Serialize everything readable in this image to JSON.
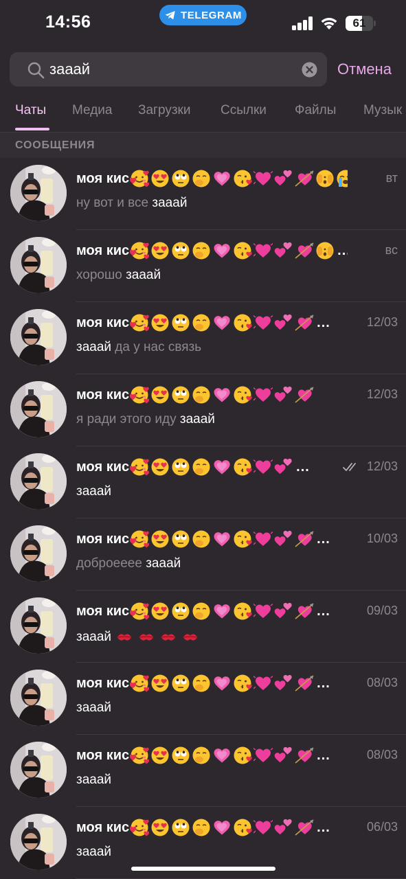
{
  "status_bar": {
    "time": "14:56",
    "app_pill": "TELEGRAM",
    "battery": "61",
    "battery_level": 0.61
  },
  "search": {
    "query": "зааай",
    "cancel_label": "Отмена"
  },
  "tabs": [
    {
      "label": "Чаты",
      "active": true
    },
    {
      "label": "Медиа",
      "active": false
    },
    {
      "label": "Загрузки",
      "active": false
    },
    {
      "label": "Ссылки",
      "active": false
    },
    {
      "label": "Файлы",
      "active": false
    },
    {
      "label": "Музык",
      "active": false
    }
  ],
  "section_header": "СООБЩЕНИЯ",
  "colors": {
    "background": "#2c282e",
    "accent": "#efbdf0",
    "telegram_blue": "#2e8fe8",
    "secondary_text": "#8d8890"
  },
  "chat_title": "моя кис",
  "results": [
    {
      "date": "вт",
      "pre": "ну вот и все ",
      "match": "зааай",
      "post": "",
      "icons": [
        "smiling-hearts",
        "heart-eyes",
        "eye-roll",
        "hand-over-mouth",
        "growing-heart",
        "kiss-face",
        "pink-heart",
        "two-hearts",
        "cupid-heart",
        "peeking-face",
        "crying-face"
      ],
      "ellipsis": false,
      "read": false,
      "kiss_marks": 0
    },
    {
      "date": "вс",
      "pre": "хорошо ",
      "match": "зааай",
      "post": "",
      "icons": [
        "smiling-hearts",
        "heart-eyes",
        "eye-roll",
        "hand-over-mouth",
        "growing-heart",
        "kiss-face",
        "pink-heart",
        "two-hearts",
        "cupid-heart",
        "peeking-face"
      ],
      "ellipsis": true,
      "read": false,
      "kiss_marks": 0
    },
    {
      "date": "12/03",
      "pre": "",
      "match": "зааай",
      "post": " да у нас связь",
      "icons": [
        "smiling-hearts",
        "heart-eyes",
        "eye-roll",
        "hand-over-mouth",
        "growing-heart",
        "kiss-face",
        "pink-heart",
        "two-hearts",
        "cupid-heart"
      ],
      "ellipsis": true,
      "read": false,
      "kiss_marks": 0
    },
    {
      "date": "12/03",
      "pre": "я ради этого иду ",
      "match": "зааай",
      "post": "",
      "icons": [
        "smiling-hearts",
        "heart-eyes",
        "eye-roll",
        "hand-over-mouth",
        "growing-heart",
        "kiss-face",
        "pink-heart",
        "two-hearts",
        "cupid-heart"
      ],
      "ellipsis": false,
      "read": false,
      "kiss_marks": 0
    },
    {
      "date": "12/03",
      "pre": "",
      "match": "зааай",
      "post": "",
      "icons": [
        "smiling-hearts",
        "heart-eyes",
        "eye-roll",
        "hand-over-mouth",
        "growing-heart",
        "kiss-face",
        "pink-heart",
        "two-hearts"
      ],
      "ellipsis": true,
      "read": true,
      "kiss_marks": 0
    },
    {
      "date": "10/03",
      "pre": "доброееее ",
      "match": "зааай",
      "post": "",
      "icons": [
        "smiling-hearts",
        "heart-eyes",
        "eye-roll",
        "hand-over-mouth",
        "growing-heart",
        "kiss-face",
        "pink-heart",
        "two-hearts",
        "cupid-heart"
      ],
      "ellipsis": true,
      "read": false,
      "kiss_marks": 0
    },
    {
      "date": "09/03",
      "pre": "",
      "match": "зааай",
      "post": " ",
      "icons": [
        "smiling-hearts",
        "heart-eyes",
        "eye-roll",
        "hand-over-mouth",
        "growing-heart",
        "kiss-face",
        "pink-heart",
        "two-hearts",
        "cupid-heart"
      ],
      "ellipsis": true,
      "read": false,
      "kiss_marks": 4
    },
    {
      "date": "08/03",
      "pre": "",
      "match": "зааай",
      "post": "",
      "icons": [
        "smiling-hearts",
        "heart-eyes",
        "eye-roll",
        "hand-over-mouth",
        "growing-heart",
        "kiss-face",
        "pink-heart",
        "two-hearts",
        "cupid-heart"
      ],
      "ellipsis": true,
      "read": false,
      "kiss_marks": 0
    },
    {
      "date": "08/03",
      "pre": "",
      "match": "зааай",
      "post": "",
      "icons": [
        "smiling-hearts",
        "heart-eyes",
        "eye-roll",
        "hand-over-mouth",
        "growing-heart",
        "kiss-face",
        "pink-heart",
        "two-hearts",
        "cupid-heart"
      ],
      "ellipsis": true,
      "read": false,
      "kiss_marks": 0
    },
    {
      "date": "06/03",
      "pre": "",
      "match": "зааай",
      "post": "",
      "icons": [
        "smiling-hearts",
        "heart-eyes",
        "eye-roll",
        "hand-over-mouth",
        "growing-heart",
        "kiss-face",
        "pink-heart",
        "two-hearts",
        "cupid-heart"
      ],
      "ellipsis": true,
      "read": false,
      "kiss_marks": 0
    }
  ]
}
